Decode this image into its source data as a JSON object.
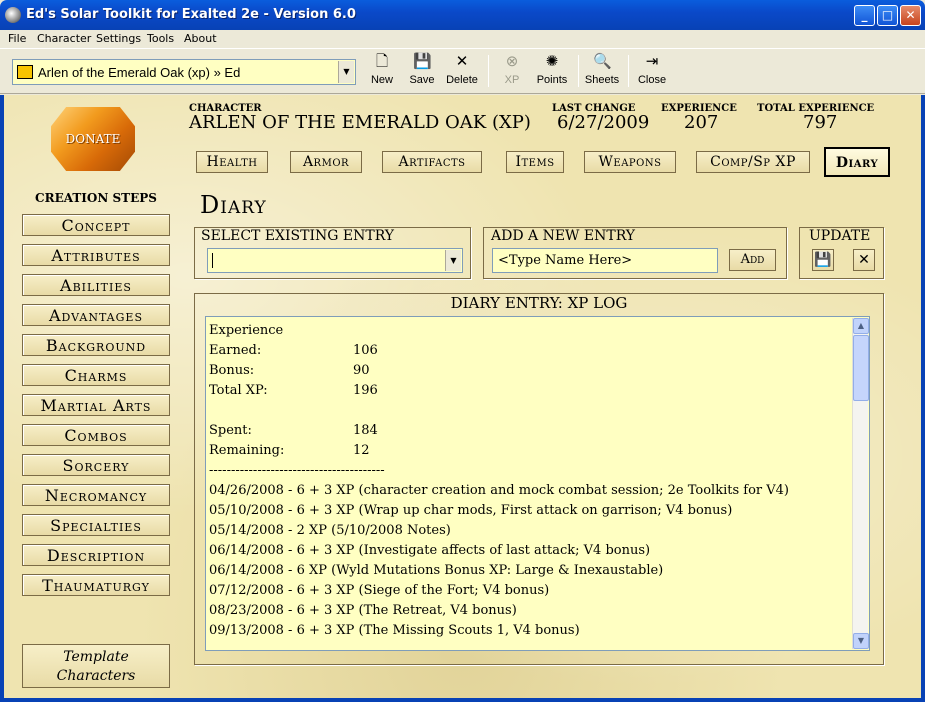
{
  "window": {
    "title": "Ed's Solar Toolkit for Exalted 2e - Version 6.0",
    "minimize_glyph": "_",
    "maximize_glyph": "□",
    "close_glyph": "✕"
  },
  "menu": [
    "File",
    "Character",
    "Settings",
    "Tools",
    "About"
  ],
  "toolbar": {
    "character_select_value": "Arlen of the Emerald Oak (xp) » Ed",
    "buttons": {
      "new": "New",
      "save": "Save",
      "delete": "Delete",
      "xp": "XP",
      "points": "Points",
      "sheets": "Sheets",
      "close": "Close"
    }
  },
  "sidebar": {
    "donate_label": "DONATE",
    "creation_title": "CREATION STEPS",
    "steps": [
      "Concept",
      "Attributes",
      "Abilities",
      "Advantages",
      "Background",
      "Charms",
      "Martial Arts",
      "Combos",
      "Sorcery",
      "Necromancy",
      "Specialties",
      "Description",
      "Thaumaturgy"
    ],
    "template_line1": "Template",
    "template_line2": "Characters"
  },
  "header": {
    "character_label": "CHARACTER",
    "character_name": "ARLEN OF THE EMERALD OAK (XP)",
    "last_change_label": "LAST CHANGE",
    "last_change_value": "6/27/2009",
    "experience_label": "EXPERIENCE",
    "experience_value": "207",
    "total_experience_label": "TOTAL EXPERIENCE",
    "total_experience_value": "797"
  },
  "tabs": [
    "Health",
    "Armor",
    "Artifacts",
    "Items",
    "Weapons",
    "Comp/Sp XP",
    "Diary"
  ],
  "active_tab": "Diary",
  "diary": {
    "section_title": "Diary",
    "select_existing_label": "SELECT EXISTING ENTRY",
    "add_new_label": "ADD A NEW ENTRY",
    "name_placeholder": "<Type Name Here>",
    "add_button": "Add",
    "update_label": "UPDATE",
    "entry_title": "DIARY ENTRY: XP LOG",
    "lines": [
      {
        "k": "Experience",
        "v": ""
      },
      {
        "k": "Earned:",
        "v": "106"
      },
      {
        "k": "Bonus:",
        "v": "90"
      },
      {
        "k": "Total XP:",
        "v": "196"
      },
      {
        "k": "",
        "v": ""
      },
      {
        "k": "Spent:",
        "v": "184"
      },
      {
        "k": "Remaining:",
        "v": "12"
      },
      {
        "k": "----------------------------------------",
        "v": ""
      },
      {
        "k": "04/26/2008 - 6 + 3 XP (character creation and mock combat session; 2e Toolkits for V4)",
        "v": ""
      },
      {
        "k": "05/10/2008 - 6 + 3 XP (Wrap up char mods, First attack on garrison; V4 bonus)",
        "v": ""
      },
      {
        "k": "05/14/2008 - 2 XP (5/10/2008 Notes)",
        "v": ""
      },
      {
        "k": "06/14/2008 - 6 + 3 XP (Investigate affects of last attack; V4 bonus)",
        "v": ""
      },
      {
        "k": "06/14/2008 - 6 XP (Wyld Mutations Bonus XP: Large & Inexaustable)",
        "v": ""
      },
      {
        "k": "07/12/2008 - 6 + 3 XP (Siege of the Fort; V4 bonus)",
        "v": ""
      },
      {
        "k": "08/23/2008 - 6 + 3 XP (The Retreat, V4 bonus)",
        "v": ""
      },
      {
        "k": "09/13/2008 - 6 + 3 XP (The Missing Scouts 1, V4 bonus)",
        "v": ""
      }
    ]
  }
}
